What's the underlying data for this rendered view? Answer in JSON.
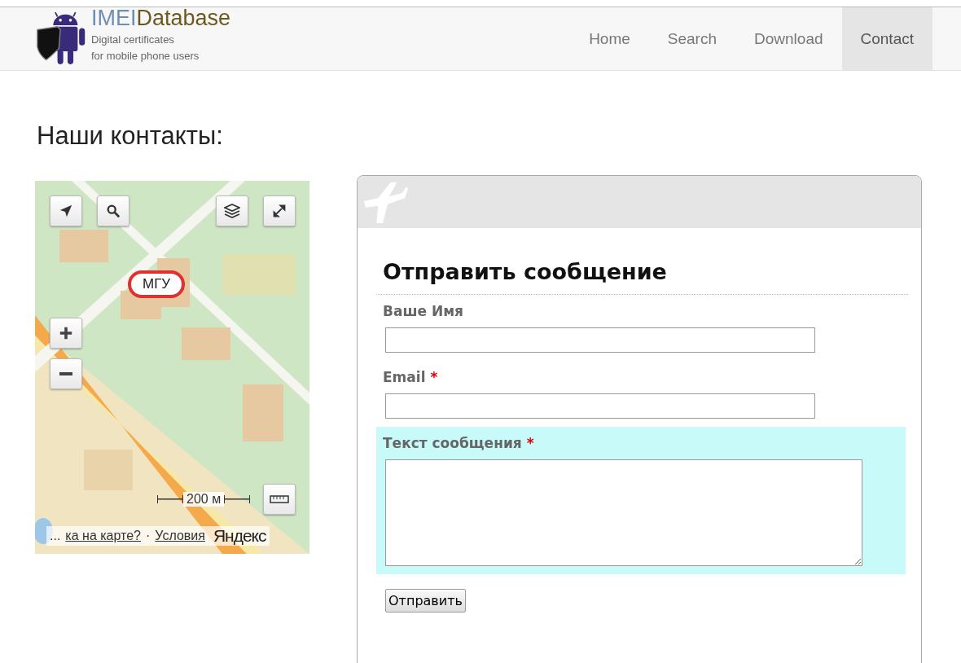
{
  "site": {
    "name_part1": "IMEI",
    "name_part2": "Database",
    "tagline_line1": "Digital certificates",
    "tagline_line2": "for mobile phone users"
  },
  "nav": [
    {
      "label": "Home",
      "selected": false
    },
    {
      "label": "Search",
      "selected": false
    },
    {
      "label": "Download",
      "selected": false
    },
    {
      "label": "Contact",
      "selected": true
    }
  ],
  "page_title": "Наши контакты:",
  "map": {
    "kind": "picture",
    "marker": "МГУ",
    "scale": "200 м",
    "footer_prefix": "...",
    "footer_link1": "ка на карте?",
    "footer_separator": "·",
    "footer_link2": "Условия",
    "logo": "Яндекс"
  },
  "form": {
    "title": "Отправить сообщение",
    "fields": [
      {
        "label": "Ваше Имя",
        "required": false,
        "kind": "input",
        "highlighted": false
      },
      {
        "label": "Email",
        "required": true,
        "kind": "input",
        "highlighted": false
      },
      {
        "label": "Текст сообщения",
        "required": true,
        "kind": "textarea",
        "highlighted": true
      }
    ],
    "required_mark": "*",
    "submit": "Отправить"
  }
}
